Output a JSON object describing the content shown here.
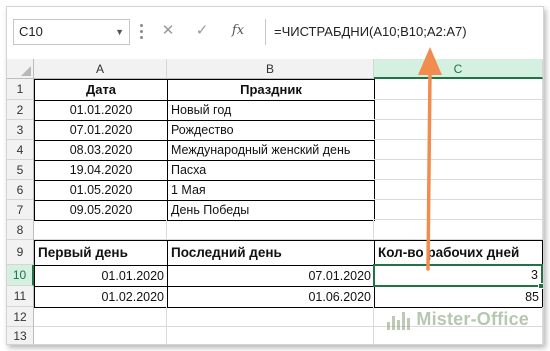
{
  "formula_bar": {
    "name_box": "C10",
    "cancel_icon": "✕",
    "enter_icon": "✓",
    "fx_label": "fx",
    "formula": "=ЧИСТРАБДНИ(A10;B10;A2:A7)"
  },
  "columns": [
    "A",
    "B",
    "C"
  ],
  "rows": [
    "1",
    "2",
    "3",
    "4",
    "5",
    "6",
    "7",
    "8",
    "9",
    "10",
    "11",
    "12",
    "13"
  ],
  "selected_cell": "C10",
  "table1": {
    "header": {
      "date": "Дата",
      "holiday": "Праздник"
    },
    "rows": [
      {
        "date": "01.01.2020",
        "holiday": "Новый год"
      },
      {
        "date": "07.01.2020",
        "holiday": "Рождество"
      },
      {
        "date": "08.03.2020",
        "holiday": "Международный женский день"
      },
      {
        "date": "19.04.2020",
        "holiday": "Пасха"
      },
      {
        "date": "01.05.2020",
        "holiday": "1 Мая"
      },
      {
        "date": "09.05.2020",
        "holiday": "День Победы"
      }
    ]
  },
  "table2": {
    "header": {
      "first_day": "Первый день",
      "last_day": "Последний день",
      "workdays": "Кол-во рабочих дней"
    },
    "rows": [
      {
        "first_day": "01.01.2020",
        "last_day": "07.01.2020",
        "workdays": "3"
      },
      {
        "first_day": "01.02.2020",
        "last_day": "01.06.2020",
        "workdays": "85"
      }
    ]
  },
  "watermark": {
    "text": "Mister-Office"
  },
  "colors": {
    "accent": "#217346",
    "arrow": "#f28c4e"
  }
}
